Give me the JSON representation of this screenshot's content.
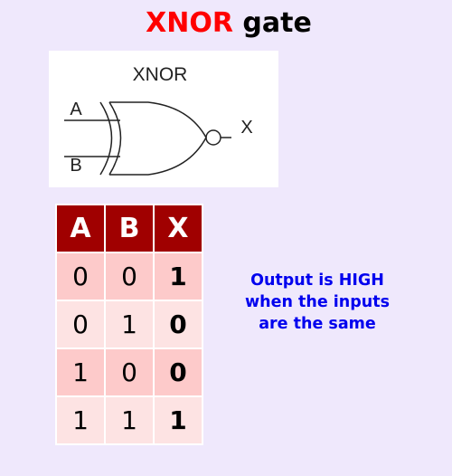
{
  "title": {
    "accent": "XNOR",
    "rest": " gate"
  },
  "diagram": {
    "gate_label": "XNOR",
    "input_a": "A",
    "input_b": "B",
    "output": "X"
  },
  "truth_table": {
    "headers": [
      "A",
      "B",
      "X"
    ],
    "rows": [
      [
        "0",
        "0",
        "1"
      ],
      [
        "0",
        "1",
        "0"
      ],
      [
        "1",
        "0",
        "0"
      ],
      [
        "1",
        "1",
        "1"
      ]
    ]
  },
  "note": {
    "lines": [
      "Output is HIGH",
      "when the inputs",
      "are the same"
    ]
  },
  "colors": {
    "background": "#efe8fc",
    "title_accent": "#ff0000",
    "table_header": "#a00000",
    "row_dark": "#fdcaca",
    "row_light": "#fde3e3",
    "note_text": "#0000ee"
  }
}
